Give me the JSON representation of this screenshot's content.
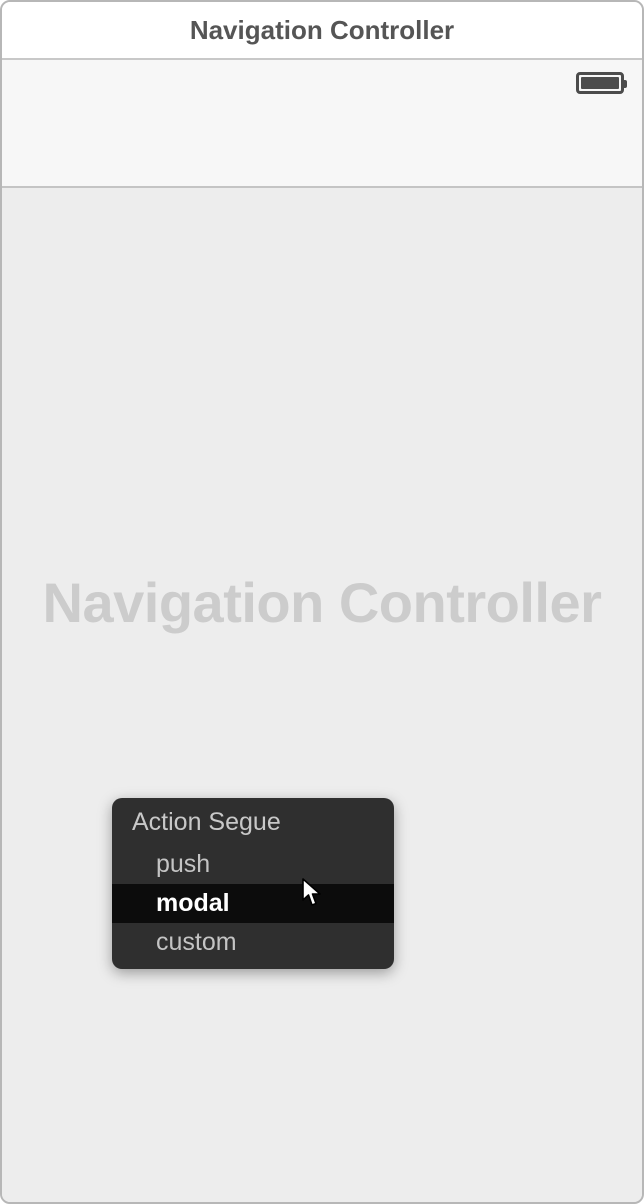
{
  "titleBar": {
    "title": "Navigation Controller"
  },
  "content": {
    "placeholderTitle": "Navigation Controller"
  },
  "popover": {
    "header": "Action Segue",
    "items": [
      {
        "label": "push",
        "selected": false
      },
      {
        "label": "modal",
        "selected": true
      },
      {
        "label": "custom",
        "selected": false
      }
    ]
  }
}
